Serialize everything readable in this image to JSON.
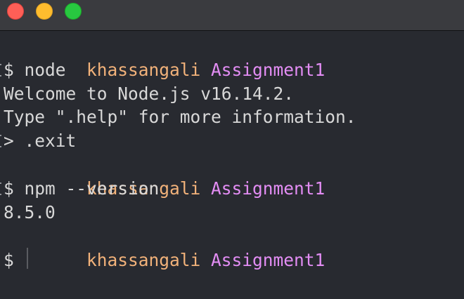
{
  "window": {
    "controls": {
      "close": "close-button",
      "minimize": "minimize-button",
      "maximize": "maximize-button"
    },
    "colors": {
      "background": "#282a30",
      "titlebar": "#3a3b3f",
      "user": "#f2b27a",
      "directory": "#e38df4",
      "text": "#d8d8d8"
    }
  },
  "terminal": {
    "prompt1": {
      "user": "khassangali",
      "dir": "Assignment1"
    },
    "cmd1": {
      "text": "$ node"
    },
    "out1": {
      "text": "Welcome to Node.js v16.14.2."
    },
    "out2": {
      "text": "Type \".help\" for more information."
    },
    "cmd2": {
      "text": "> .exit"
    },
    "prompt2": {
      "user": "khassangali",
      "dir": "Assignment1"
    },
    "cmd3": {
      "text": "$ npm --version"
    },
    "out3": {
      "text": "8.5.0"
    },
    "prompt3": {
      "user": "khassangali",
      "dir": "Assignment1"
    },
    "cmd4": {
      "text": "$ "
    }
  }
}
